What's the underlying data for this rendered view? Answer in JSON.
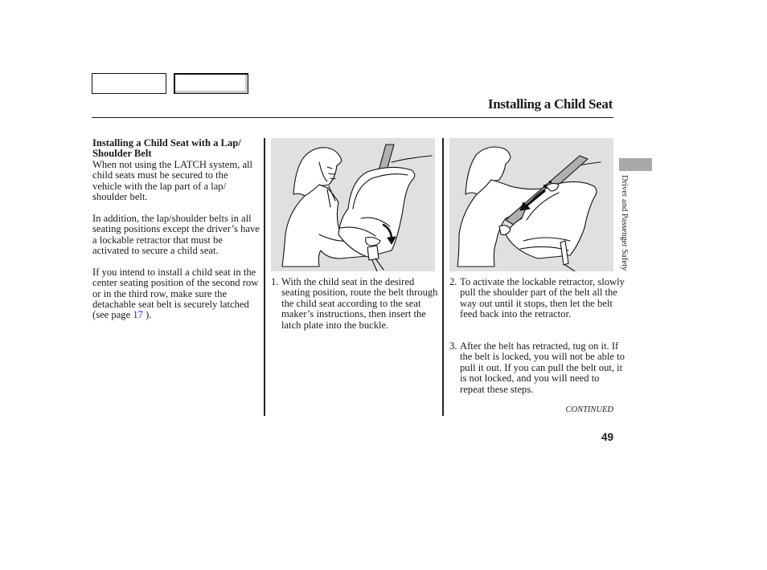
{
  "header": {
    "nav_boxes": [
      "",
      ""
    ],
    "title": "Installing a Child Seat"
  },
  "left_column": {
    "heading_line1": "Installing a Child Seat with a Lap/",
    "heading_line2": "Shoulder Belt",
    "paragraph1": "When not using the LATCH system, all child seats must be secured to the vehicle with the lap part of a lap/ shoulder belt.",
    "paragraph2": "In addition, the lap/shoulder belts in all seating positions except the driver’s have a lockable retractor that must be activated to secure a child seat.",
    "paragraph3_before_link": "If you intend to install a child seat in the center seating position of the second row or in the third row, make sure the detachable seat belt is securely latched (see page ",
    "paragraph3_link": "17",
    "paragraph3_after_link": " )."
  },
  "figures": [
    {
      "icon": "child-seat-routing-illustration",
      "description": "Woman placing child seat and inserting latch plate into buckle"
    },
    {
      "icon": "retractor-pull-illustration",
      "description": "Woman pulling shoulder belt out to activate lockable retractor"
    }
  ],
  "steps": [
    {
      "number": "1.",
      "text": "With the child seat in the desired seating position, route the belt through the child seat according to the seat maker’s instructions, then insert the latch plate into the buckle."
    },
    {
      "number": "2.",
      "text": "To activate the lockable retractor, slowly pull the shoulder part of the belt all the way out until it stops, then let the belt feed back into the retractor."
    },
    {
      "number": "3.",
      "text": "After the belt has retracted, tug on it. If the belt is locked, you will not be able to pull it out. If you can pull the belt out, it is not locked, and you will need to repeat these steps."
    }
  ],
  "footer": {
    "continued": "CONTINUED",
    "page_number": "49"
  },
  "side_tab": {
    "label": "Driver and Passenger Safety"
  },
  "colors": {
    "link": "#1a1adc",
    "figure_background": "#e0e0e0",
    "side_tab": "#a9a9a9"
  }
}
